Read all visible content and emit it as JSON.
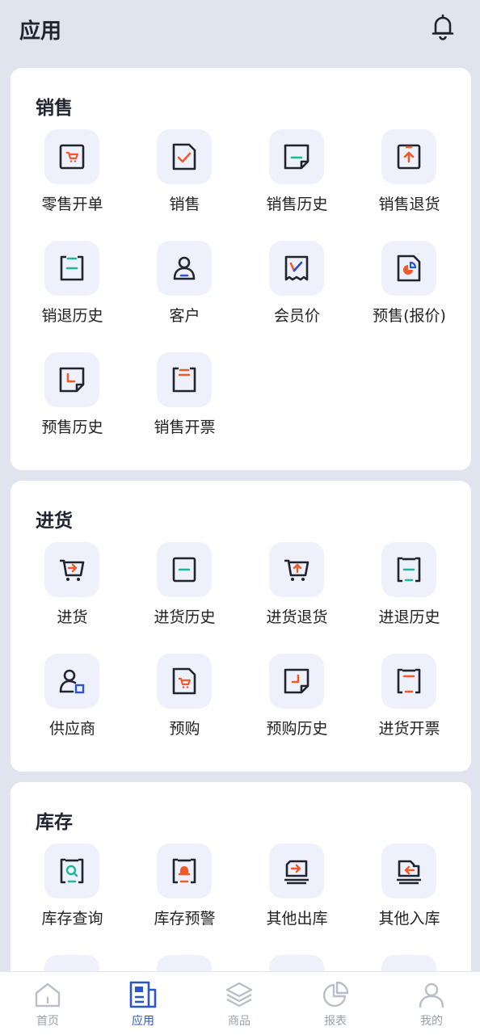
{
  "header": {
    "title": "应用"
  },
  "sections": {
    "sales": {
      "title": "销售",
      "items": [
        "零售开单",
        "销售",
        "销售历史",
        "销售退货",
        "销退历史",
        "客户",
        "会员价",
        "预售(报价)",
        "预售历史",
        "销售开票"
      ]
    },
    "purchase": {
      "title": "进货",
      "items": [
        "进货",
        "进货历史",
        "进货退货",
        "进退历史",
        "供应商",
        "预购",
        "预购历史",
        "进货开票"
      ]
    },
    "inventory": {
      "title": "库存",
      "items": [
        "库存查询",
        "库存预警",
        "其他出库",
        "其他入库"
      ]
    }
  },
  "tabbar": {
    "items": [
      "首页",
      "应用",
      "商品",
      "报表",
      "我的"
    ],
    "active": "应用"
  },
  "colors": {
    "accent": "#2b55c8",
    "orange": "#f05a28",
    "teal": "#1fb59a",
    "background": "#dfe4ef",
    "icon_bg": "#eef1fb"
  }
}
